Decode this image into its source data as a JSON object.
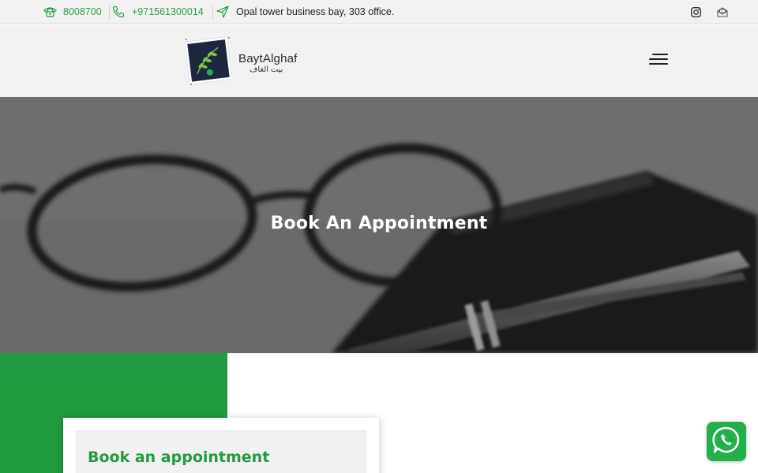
{
  "topbar": {
    "phone_short": "8008700",
    "phone_mobile": "+971561300014",
    "address": "Opal tower business bay, 303 office."
  },
  "header": {
    "logo_name": "BaytAlghaf",
    "logo_arabic": "بيت الغاف"
  },
  "hero": {
    "title": "Book An Appointment"
  },
  "booking": {
    "card_title": "Book an appointment"
  },
  "colors": {
    "brand_green": "#1f9a3e",
    "topbar_bg": "#f2f2f2",
    "whatsapp_green": "#21b04a"
  },
  "icons": {
    "phone_short": "telephone-icon",
    "phone_mobile": "phone-handset-icon",
    "address": "location-arrow-icon",
    "instagram": "instagram-icon",
    "email": "email-icon",
    "menu": "hamburger-menu-icon",
    "whatsapp": "whatsapp-icon"
  }
}
